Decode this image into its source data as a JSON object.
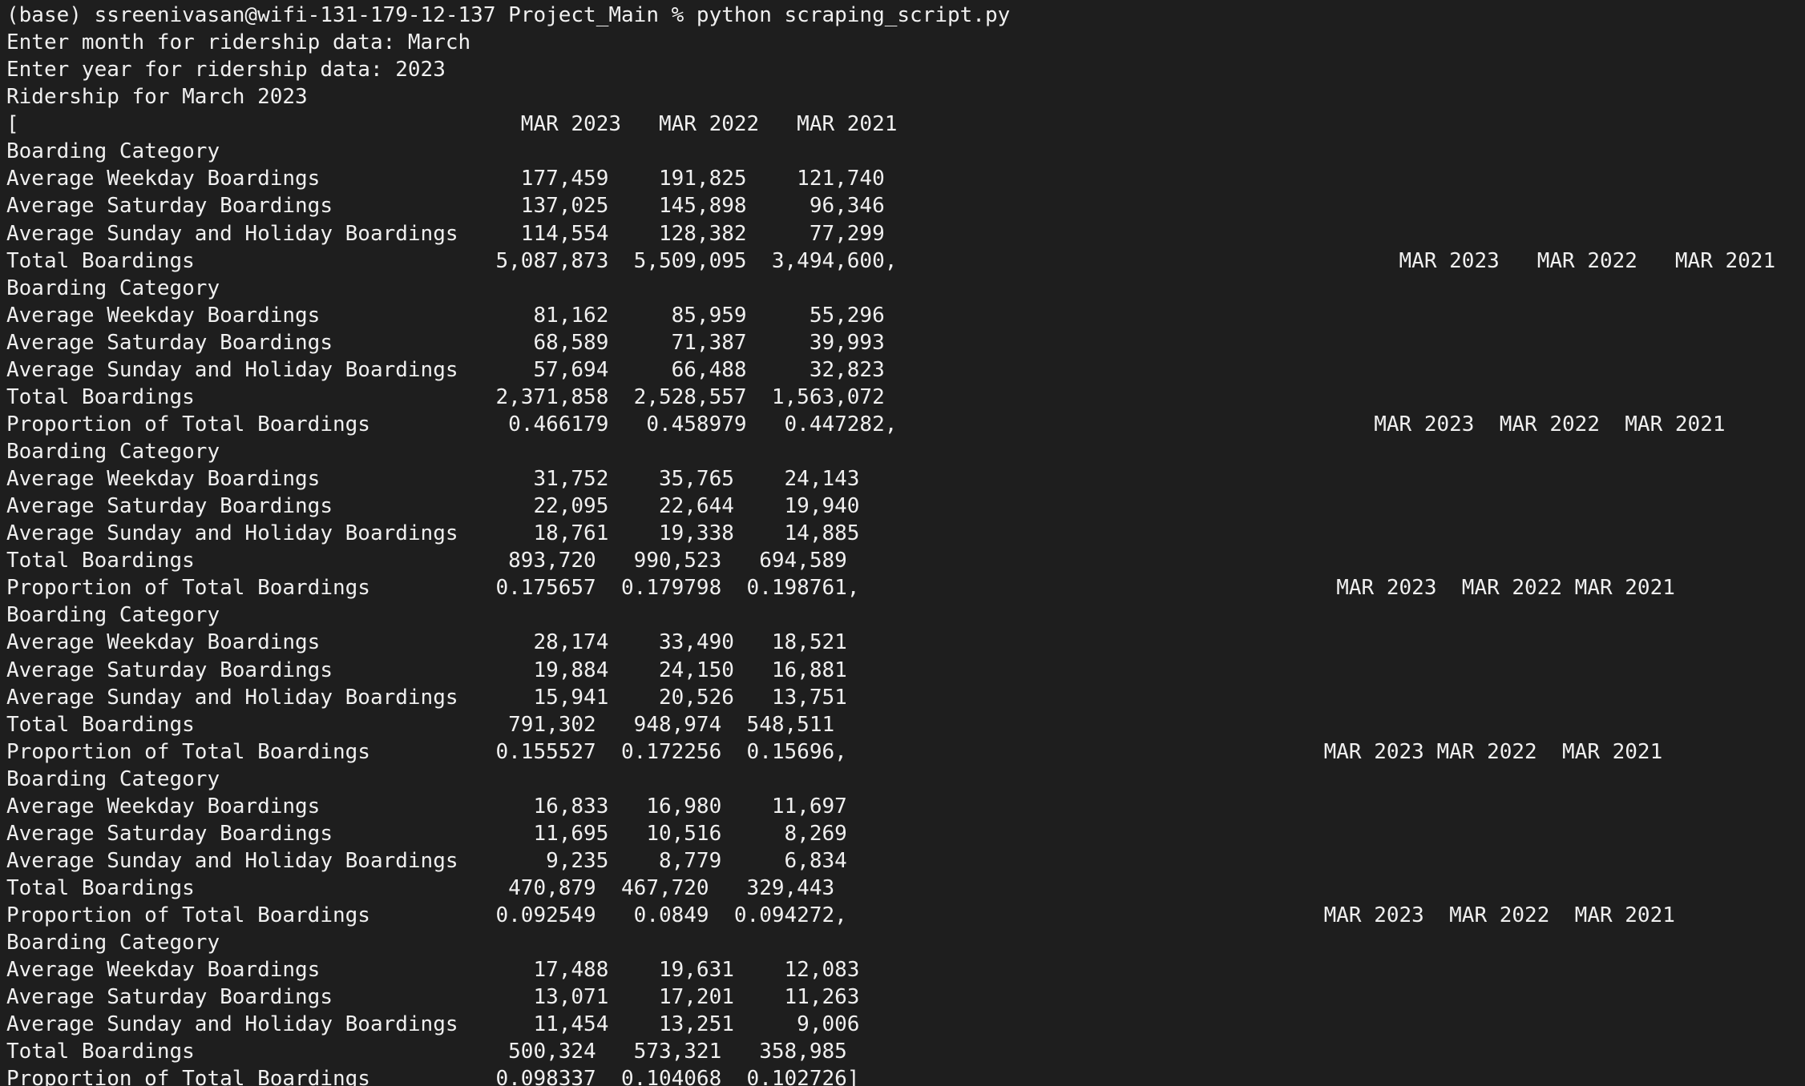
{
  "terminal": {
    "background_color": "#1e1e1e",
    "text_color": "#f0f0f0",
    "lines": [
      "(base) ssreenivasan@wifi-131-179-12-137 Project_Main % python scraping_script.py",
      "Enter month for ridership data: March",
      "Enter year for ridership data: 2023",
      "Ridership for March 2023",
      "[                                        MAR 2023   MAR 2022   MAR 2021",
      "Boarding Category",
      "Average Weekday Boardings                177,459    191,825    121,740",
      "Average Saturday Boardings               137,025    145,898     96,346",
      "Average Sunday and Holiday Boardings     114,554    128,382     77,299",
      "Total Boardings                        5,087,873  5,509,095  3,494,600,                                        MAR 2023   MAR 2022   MAR 2021",
      "Boarding Category",
      "Average Weekday Boardings                 81,162     85,959     55,296",
      "Average Saturday Boardings                68,589     71,387     39,993",
      "Average Sunday and Holiday Boardings      57,694     66,488     32,823",
      "Total Boardings                        2,371,858  2,528,557  1,563,072",
      "Proportion of Total Boardings           0.466179   0.458979   0.447282,                                      MAR 2023  MAR 2022  MAR 2021",
      "Boarding Category",
      "Average Weekday Boardings                 31,752    35,765    24,143",
      "Average Saturday Boardings                22,095    22,644    19,940",
      "Average Sunday and Holiday Boardings      18,761    19,338    14,885",
      "Total Boardings                         893,720   990,523   694,589",
      "Proportion of Total Boardings          0.175657  0.179798  0.198761,                                      MAR 2023  MAR 2022 MAR 2021",
      "Boarding Category",
      "Average Weekday Boardings                 28,174    33,490   18,521",
      "Average Saturday Boardings                19,884    24,150   16,881",
      "Average Sunday and Holiday Boardings      15,941    20,526   13,751",
      "Total Boardings                         791,302   948,974  548,511",
      "Proportion of Total Boardings          0.155527  0.172256  0.15696,                                      MAR 2023 MAR 2022  MAR 2021",
      "Boarding Category",
      "Average Weekday Boardings                 16,833   16,980    11,697",
      "Average Saturday Boardings                11,695   10,516     8,269",
      "Average Sunday and Holiday Boardings       9,235    8,779     6,834",
      "Total Boardings                         470,879  467,720   329,443",
      "Proportion of Total Boardings          0.092549   0.0849  0.094272,                                      MAR 2023  MAR 2022  MAR 2021",
      "Boarding Category",
      "Average Weekday Boardings                 17,488    19,631    12,083",
      "Average Saturday Boardings                13,071    17,201    11,263",
      "Average Sunday and Holiday Boardings      11,454    13,251     9,006",
      "Total Boardings                         500,324   573,321   358,985",
      "Proportion of Total Boardings          0.098337  0.104068  0.102726]"
    ]
  }
}
